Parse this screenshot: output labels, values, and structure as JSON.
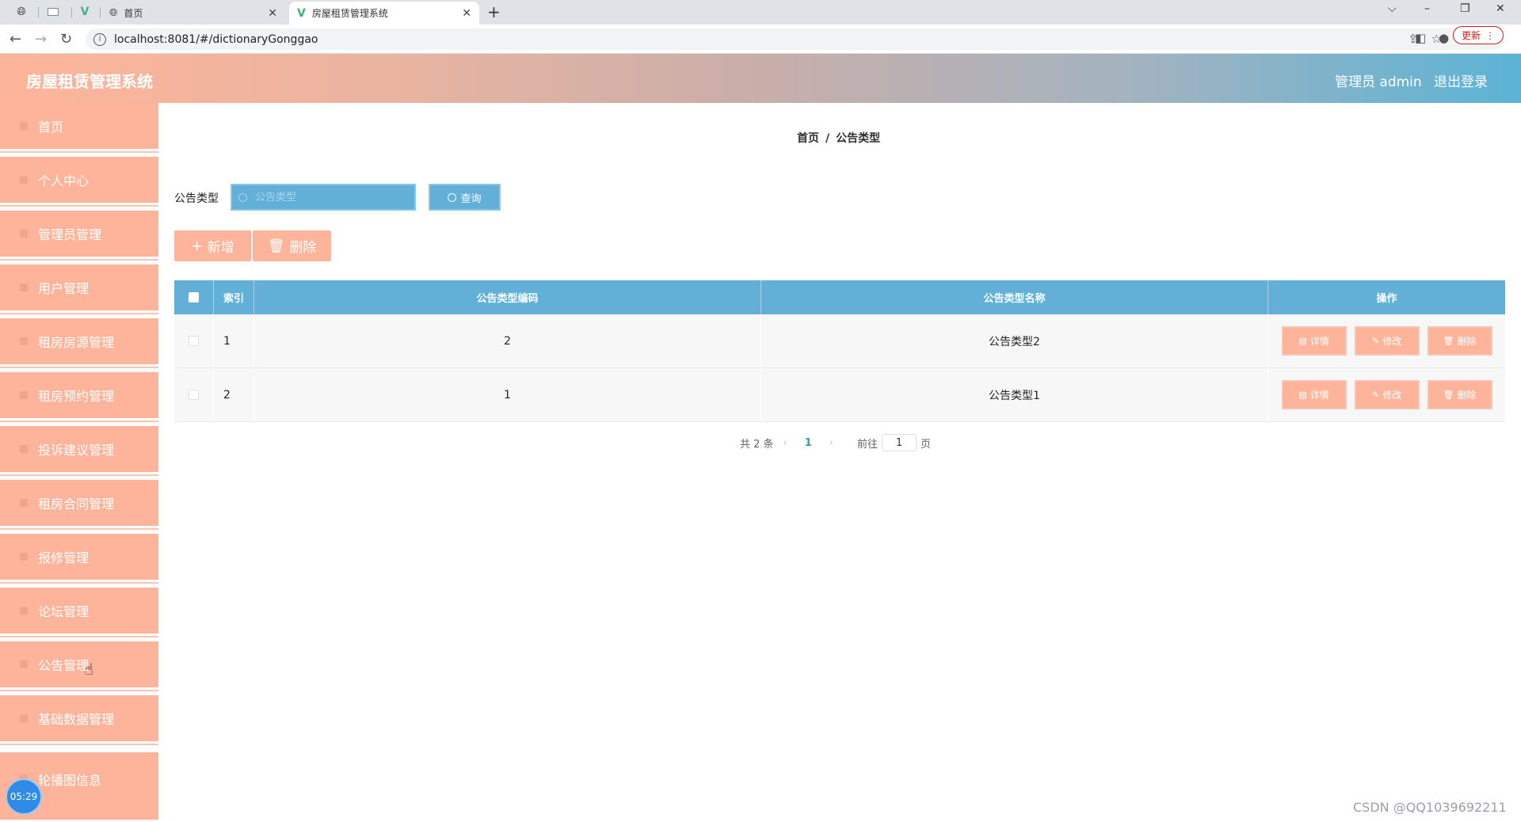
{
  "browser": {
    "tabs": [
      {
        "title": "首页",
        "close": "✕"
      },
      {
        "title": "房屋租赁管理系统",
        "close": "✕"
      }
    ],
    "new_tab": "+",
    "url": "localhost:8081/#/dictionaryGonggao",
    "update_label": "更新",
    "window_controls": {
      "dropdown": "⌵",
      "minimize": "–",
      "restore": "❐",
      "close": "✕"
    }
  },
  "header": {
    "app_title": "房屋租赁管理系统",
    "user": "管理员 admin",
    "logout": "退出登录"
  },
  "sidebar": {
    "items": [
      {
        "label": "首页"
      },
      {
        "label": "个人中心"
      },
      {
        "label": "管理员管理"
      },
      {
        "label": "用户管理"
      },
      {
        "label": "租房房源管理"
      },
      {
        "label": "租房预约管理"
      },
      {
        "label": "投诉建议管理"
      },
      {
        "label": "租房合同管理"
      },
      {
        "label": "报修管理"
      },
      {
        "label": "论坛管理"
      },
      {
        "label": "公告管理"
      },
      {
        "label": "基础数据管理"
      },
      {
        "label": "轮播图信息"
      }
    ]
  },
  "timer": "05:29",
  "breadcrumb": {
    "home": "首页",
    "separator": "/",
    "current": "公告类型"
  },
  "search": {
    "label": "公告类型",
    "placeholder": "公告类型",
    "value": "",
    "button": "查询"
  },
  "actions": {
    "add": "新增",
    "delete": "删除"
  },
  "table": {
    "headers": {
      "index": "索引",
      "code": "公告类型编码",
      "name": "公告类型名称",
      "ops": "操作"
    },
    "rows": [
      {
        "index": "1",
        "code": "2",
        "name": "公告类型2"
      },
      {
        "index": "2",
        "code": "1",
        "name": "公告类型1"
      }
    ],
    "row_actions": {
      "detail": "详情",
      "edit": "修改",
      "delete": "删除"
    }
  },
  "pagination": {
    "total": "共 2 条",
    "current_page": "1",
    "goto_label": "前往",
    "goto_value": "1",
    "page_suffix": "页"
  },
  "watermark": "CSDN @QQ1039692211",
  "colors": {
    "primary": "#62b0d8",
    "accent": "#fdb49a",
    "header_start": "#fdb59a",
    "header_end": "#5bb3d6"
  }
}
